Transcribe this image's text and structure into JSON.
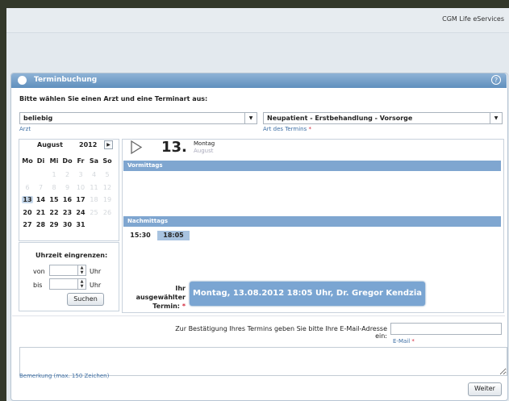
{
  "header": {
    "brand": "CGM Life eServices"
  },
  "panel": {
    "title": "Terminbuchung",
    "help": "?",
    "instruction": "Bitte wählen Sie einen Arzt und eine Terminart aus:"
  },
  "doctor_select": {
    "value": "beliebig",
    "caption": "Arzt"
  },
  "type_select": {
    "value": "Neupatient - Erstbehandlung - Vorsorge",
    "caption": "Art des Termins",
    "required": "*"
  },
  "calendar": {
    "month": "August",
    "year": "2012",
    "weekdays": [
      "Mo",
      "Di",
      "Mi",
      "Do",
      "Fr",
      "Sa",
      "So"
    ],
    "weeks": [
      [
        "",
        "",
        "1",
        "2",
        "3",
        "4",
        "5"
      ],
      [
        "6",
        "7",
        "8",
        "9",
        "10",
        "11",
        "12"
      ],
      [
        "13",
        "14",
        "15",
        "16",
        "17",
        "18",
        "19"
      ],
      [
        "20",
        "21",
        "22",
        "23",
        "24",
        "25",
        "26"
      ],
      [
        "27",
        "28",
        "29",
        "30",
        "31",
        "",
        ""
      ]
    ],
    "active_days": [
      "13",
      "14",
      "15",
      "16",
      "17",
      "20",
      "21",
      "22",
      "23",
      "24",
      "27",
      "28",
      "29",
      "30",
      "31"
    ],
    "selected_day": "13"
  },
  "time_filter": {
    "title": "Uhrzeit eingrenzen:",
    "from_label": "von",
    "to_label": "bis",
    "unit": "Uhr",
    "search_button": "Suchen"
  },
  "schedule": {
    "day_number": "13.",
    "day_name": "Montag",
    "month_name": "August",
    "morning_label": "Vormittags",
    "afternoon_label": "Nachmittags",
    "slots": [
      "15:30",
      "18:05"
    ],
    "selected_slot": "18:05"
  },
  "selection": {
    "label_line1": "Ihr ausgewählter",
    "label_line2": "Termin:",
    "required": "*",
    "value": "Montag, 13.08.2012 18:05 Uhr, Dr. Gregor Kendzia"
  },
  "email": {
    "label": "Zur Bestätigung Ihres Termins geben Sie bitte Ihre E-Mail-Adresse ein:",
    "caption": "E-Mail",
    "required": "*",
    "value": ""
  },
  "remark": {
    "caption": "Bemerkung (max. 150 Zeichen)",
    "value": ""
  },
  "next_button": "Weiter",
  "colors": {
    "accent": "#7fa6d0",
    "title_bar": "#6f9ac6",
    "required": "#d2263a",
    "link": "#3e6fa4"
  }
}
